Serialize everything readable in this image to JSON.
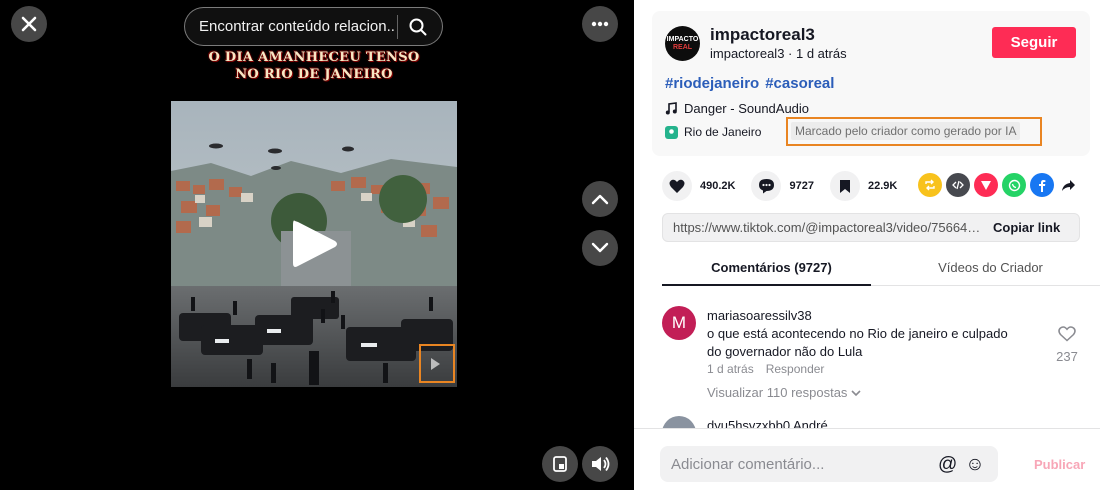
{
  "video": {
    "search_placeholder": "Encontrar conteúdo relacion...",
    "caption_overlay": "O dia amanheceu tenso no Rio de Janeiro",
    "buttons": {
      "close": "close-icon",
      "more": "more-horizontal-icon",
      "previous": "chevron-up-icon",
      "next": "chevron-down-icon",
      "captions": "floating-player-icon",
      "volume": "volume-icon",
      "play": "play-icon"
    }
  },
  "author": {
    "avatar_text_top": "IMPACTO",
    "avatar_text_bottom": "REAL",
    "name": "impactoreal3",
    "meta": "impactoreal3 · 1 d atrás",
    "follow_label": "Seguir"
  },
  "post": {
    "hashtags": [
      "#riodejaneiro",
      "#casoreal"
    ],
    "music": "Danger - SoundAudio",
    "location": "Rio de Janeiro",
    "ai_label": "Marcado pelo criador como gerado por IA"
  },
  "stats": {
    "likes": "490.2K",
    "comments": "9727",
    "saves": "22.9K"
  },
  "share": {
    "link": "https://www.tiktok.com/@impactoreal3/video/756641...",
    "copy_label": "Copiar link",
    "icons": [
      "repost-icon",
      "embed-icon",
      "send-icon",
      "whatsapp-icon",
      "facebook-icon",
      "share-arrow-icon"
    ]
  },
  "tabs": {
    "comments": "Comentários (9727)",
    "creator_videos": "Vídeos do Criador"
  },
  "comments": [
    {
      "avatar_letter": "M",
      "user": "mariasoaressilv38",
      "text": "o que está acontecendo no Rio de janeiro e culpado do governador não do Lula",
      "time": "1 d atrás",
      "reply_label": "Responder",
      "replies": "Visualizar 110 respostas",
      "likes": "237"
    },
    {
      "user": "dyu5hsvzxbb0 André"
    }
  ],
  "composer": {
    "placeholder": "Adicionar comentário...",
    "mention_icon": "@",
    "emoji_icon": "☺",
    "publish_label": "Publicar"
  }
}
